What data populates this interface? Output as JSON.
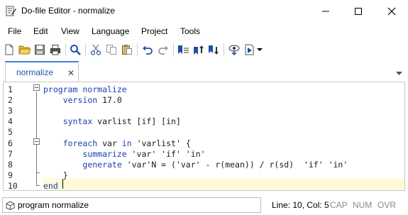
{
  "window": {
    "title": "Do-file Editor - normalize"
  },
  "menu": {
    "items": [
      "File",
      "Edit",
      "View",
      "Language",
      "Project",
      "Tools"
    ]
  },
  "toolbar": {
    "icons": [
      "new-file-icon",
      "open-folder-icon",
      "save-icon",
      "print-icon",
      "find-icon",
      "cut-icon",
      "copy-icon",
      "paste-icon",
      "undo-icon",
      "redo-icon",
      "toggle-bookmark-icon",
      "previous-bookmark-icon",
      "next-bookmark-icon",
      "show-file-in-viewer-icon",
      "execute-icon",
      "dropdown-arrow-icon"
    ]
  },
  "tabs": [
    {
      "label": "normalize",
      "close": "✕"
    }
  ],
  "editor": {
    "line_numbers": [
      "1",
      "2",
      "3",
      "4",
      "5",
      "6",
      "7",
      "8",
      "9",
      "10"
    ],
    "lines": [
      [
        {
          "t": "program normalize",
          "c": "kw"
        }
      ],
      [
        {
          "t": "    ",
          "c": "txt"
        },
        {
          "t": "version",
          "c": "kw"
        },
        {
          "t": " 17.0",
          "c": "txt"
        }
      ],
      [
        {
          "t": "",
          "c": "txt"
        }
      ],
      [
        {
          "t": "    ",
          "c": "txt"
        },
        {
          "t": "syntax",
          "c": "kw"
        },
        {
          "t": " varlist [if] [in]",
          "c": "txt"
        }
      ],
      [
        {
          "t": "",
          "c": "txt"
        }
      ],
      [
        {
          "t": "    ",
          "c": "txt"
        },
        {
          "t": "foreach",
          "c": "kw"
        },
        {
          "t": " var ",
          "c": "txt"
        },
        {
          "t": "in",
          "c": "kw"
        },
        {
          "t": " 'varlist' {",
          "c": "txt"
        }
      ],
      [
        {
          "t": "        ",
          "c": "txt"
        },
        {
          "t": "summarize",
          "c": "kw"
        },
        {
          "t": " 'var' 'if' 'in'",
          "c": "txt"
        }
      ],
      [
        {
          "t": "        ",
          "c": "txt"
        },
        {
          "t": "generate",
          "c": "kw"
        },
        {
          "t": " 'var'N = ('var' - r(mean)) / r(sd)  'if' 'in'",
          "c": "txt"
        }
      ],
      [
        {
          "t": "    }",
          "c": "txt"
        }
      ],
      [
        {
          "t": "end",
          "c": "kw"
        }
      ]
    ]
  },
  "status": {
    "combo_value": "program normalize",
    "position": "Line: 10, Col: 5",
    "cap": "CAP",
    "num": "NUM",
    "ovr": "OVR"
  },
  "colors": {
    "keyword": "#1a3fb5",
    "tab_accent": "#3c7fd6",
    "current_line": "#fffbd9"
  }
}
